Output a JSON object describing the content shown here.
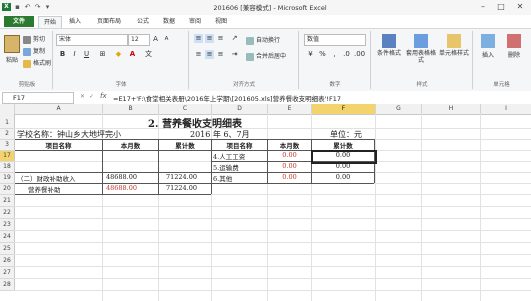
{
  "window": {
    "title": "201606 [兼容模式] - Microsoft Excel",
    "quick_access": [
      "save-icon",
      "undo-icon",
      "redo-icon"
    ],
    "controls": [
      "minimize-icon",
      "maximize-icon",
      "close-icon"
    ]
  },
  "ribbon_tabs": [
    "文件",
    "开始",
    "插入",
    "页面布局",
    "公式",
    "数据",
    "审阅",
    "视图"
  ],
  "ribbon": {
    "clipboard": {
      "paste": "粘贴",
      "cut": "剪切",
      "copy": "复制",
      "format_painter": "格式刷",
      "label": "剪贴板"
    },
    "font": {
      "name": "宋体",
      "size": "12",
      "label": "字体",
      "bold": "B",
      "italic": "I",
      "underline": "U"
    },
    "alignment": {
      "wrap": "自动换行",
      "merge": "合并后居中",
      "label": "对齐方式"
    },
    "number": {
      "format": "数值",
      "label": "数字"
    },
    "styles": {
      "conditional": "条件格式",
      "table": "套用表格格式",
      "cell": "单元格样式",
      "label": "样式"
    },
    "cells": {
      "insert": "插入",
      "delete": "删除",
      "label": "单元格"
    }
  },
  "formula_bar": {
    "name_box": "F17",
    "fx": "fx",
    "formula": "=E17+'F:\\食堂相关表册\\2016年上学期\\[201605.xls]营养餐收支明细表'!F17"
  },
  "columns": [
    "A",
    "B",
    "C",
    "D",
    "E",
    "F",
    "G",
    "H",
    "I"
  ],
  "selected_column": "F",
  "rows": [
    "1",
    "2",
    "3",
    "17",
    "18",
    "19",
    "20",
    "21",
    "22",
    "23",
    "24",
    "25",
    "26",
    "27",
    "28"
  ],
  "selected_row": "17",
  "sheet": {
    "title": "2. 营养餐收支明细表",
    "school_label": "学校名称：钟山乡大地坪完小",
    "period": "2016 年 6、7月",
    "unit": "单位：元",
    "headers": [
      "项目名称",
      "本月数",
      "累计数",
      "项目名称",
      "本月数",
      "累计数"
    ],
    "r17": {
      "d": "4.人工工资",
      "e": "0.00",
      "f": "0.00"
    },
    "r18": {
      "d": "5.运输费",
      "e": "0.00",
      "f": "0.00"
    },
    "r19": {
      "a": "（二）财政补助收入",
      "b": "48688.00",
      "c": "71224.00",
      "d": "6.其他",
      "e": "0.00",
      "f": "0.00"
    },
    "r20": {
      "a": "营养餐补助",
      "b": "48688.00",
      "c": "71224.00"
    }
  }
}
